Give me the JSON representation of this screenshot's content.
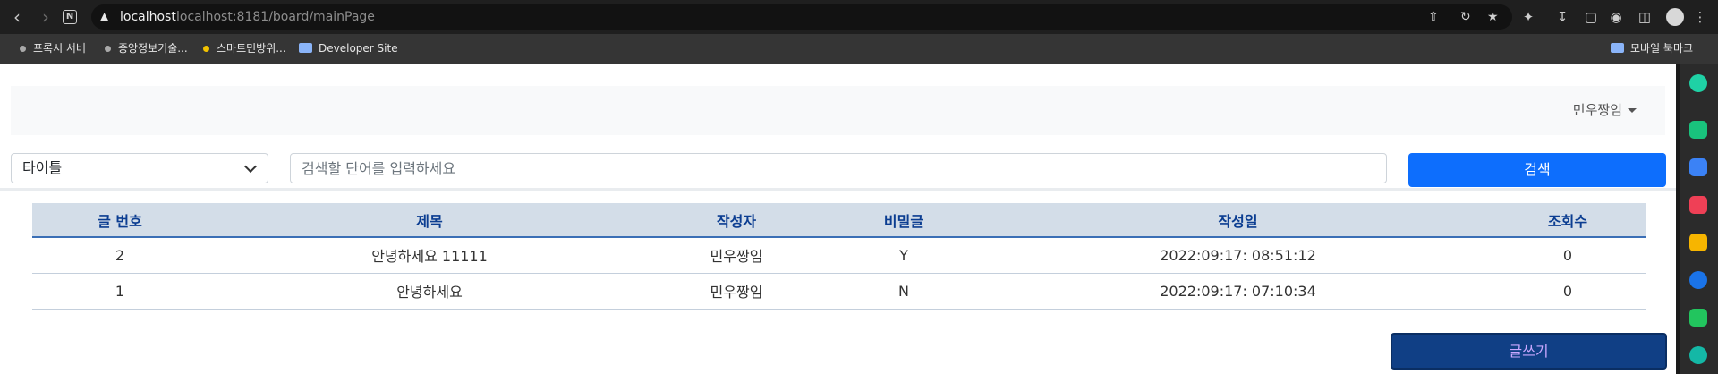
{
  "browser": {
    "host": "localhost",
    "url": "localhost:8181/board/mainPage",
    "bookmarks": [
      {
        "label": "프록시 서버",
        "icon": "dot"
      },
      {
        "label": "중앙정보기술...",
        "icon": "dot"
      },
      {
        "label": "스마트민방위...",
        "icon": "dot-yellow"
      },
      {
        "label": "Developer Site",
        "icon": "folder"
      }
    ],
    "bookmarks_right": {
      "label": "모바일 북마크",
      "icon": "folder"
    }
  },
  "header": {
    "user_name": "민우짱임"
  },
  "search": {
    "category": "타이틀",
    "placeholder": "검색할 단어를 입력하세요",
    "value": "",
    "button_label": "검색"
  },
  "table": {
    "columns": [
      "글 번호",
      "제목",
      "작성자",
      "비밀글",
      "작성일",
      "조회수"
    ],
    "rows": [
      {
        "no": "2",
        "title": "안녕하세요 11111",
        "author": "민우짱임",
        "secret": "Y",
        "date": "2022:09:17: 08:51:12",
        "views": "0"
      },
      {
        "no": "1",
        "title": "안녕하세요",
        "author": "민우짱임",
        "secret": "N",
        "date": "2022:09:17: 07:10:34",
        "views": "0"
      }
    ]
  },
  "actions": {
    "write_label": "글쓰기"
  },
  "colors": {
    "primary": "#0d6efd",
    "write_button": "#103f85",
    "table_header": "#d3dde8"
  }
}
